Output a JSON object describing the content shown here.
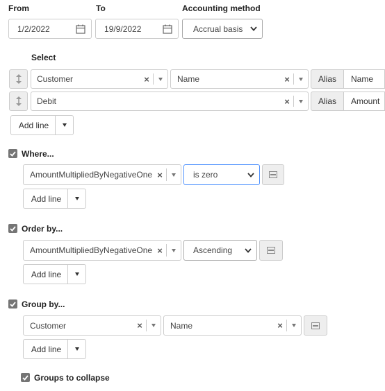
{
  "dates": {
    "from_label": "From",
    "from_value": "1/2/2022",
    "to_label": "To",
    "to_value": "19/9/2022",
    "method_label": "Accounting method",
    "method_value": "Accrual basis"
  },
  "select": {
    "label": "Select",
    "rows": [
      {
        "field": "Customer",
        "subfield": "Name",
        "alias_label": "Alias",
        "alias_value": "Name"
      },
      {
        "field": "Debit",
        "alias_label": "Alias",
        "alias_value": "Amount"
      }
    ],
    "add_line": "Add line"
  },
  "where": {
    "label": "Where...",
    "checked": true,
    "field": "AmountMultipliedByNegativeOne",
    "operator": "is zero",
    "add_line": "Add line"
  },
  "order_by": {
    "label": "Order by...",
    "checked": true,
    "field": "AmountMultipliedByNegativeOne",
    "direction": "Ascending",
    "add_line": "Add line"
  },
  "group_by": {
    "label": "Group by...",
    "checked": true,
    "field": "Customer",
    "subfield": "Name",
    "add_line": "Add line"
  },
  "collapse": {
    "label": "Groups to collapse",
    "checked": true
  },
  "colors": {
    "checkbox": "#757575",
    "focus_border": "#4d90fe"
  }
}
